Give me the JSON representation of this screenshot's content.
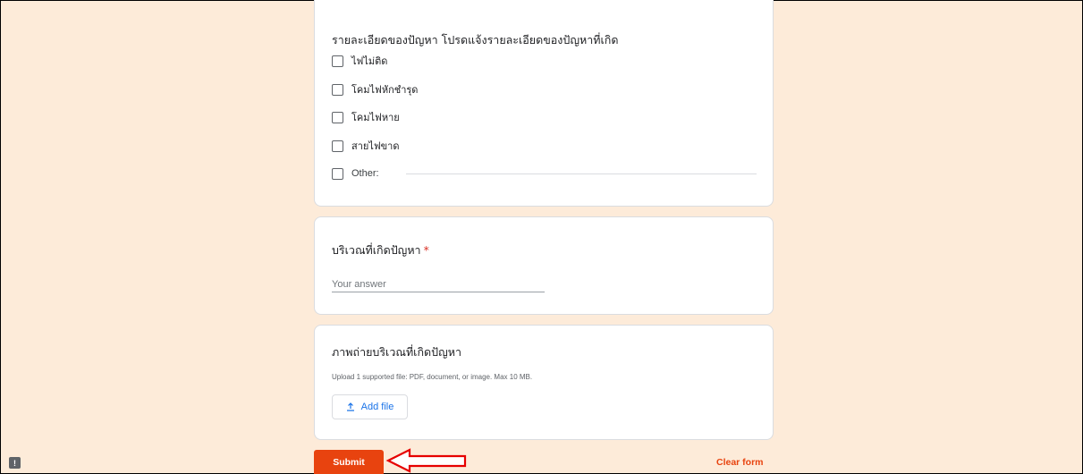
{
  "details_card": {
    "title": "รายละเอียดของปัญหา โปรดแจ้งรายละเอียดของปัญหาที่เกิด",
    "options": [
      {
        "label": "ไฟไม่ติด",
        "checked": false
      },
      {
        "label": "โคมไฟหักชำรุด",
        "checked": false
      },
      {
        "label": "โคมไฟหาย",
        "checked": false
      },
      {
        "label": "สายไฟขาด",
        "checked": false
      },
      {
        "label": "Other:",
        "checked": false
      }
    ]
  },
  "location_card": {
    "title": "บริเวณที่เกิดปัญหา",
    "required_mark": "*",
    "answer_placeholder": "Your answer",
    "answer_value": ""
  },
  "photo_card": {
    "title": "ภาพถ่ายบริเวณที่เกิดปัญหา",
    "upload_note": "Upload 1 supported file: PDF, document, or image. Max 10 MB.",
    "add_file_label": "Add file",
    "add_file_icon": "upload-icon"
  },
  "footer": {
    "submit_label": "Submit",
    "clear_label": "Clear form",
    "feedback_icon": "feedback-icon",
    "feedback_glyph": "!"
  },
  "colors": {
    "page_background": "#fdebd9",
    "accent": "#e8430f",
    "link_blue": "#1a73e8",
    "required_red": "#d93025",
    "annotation_arrow": "#e60000"
  }
}
